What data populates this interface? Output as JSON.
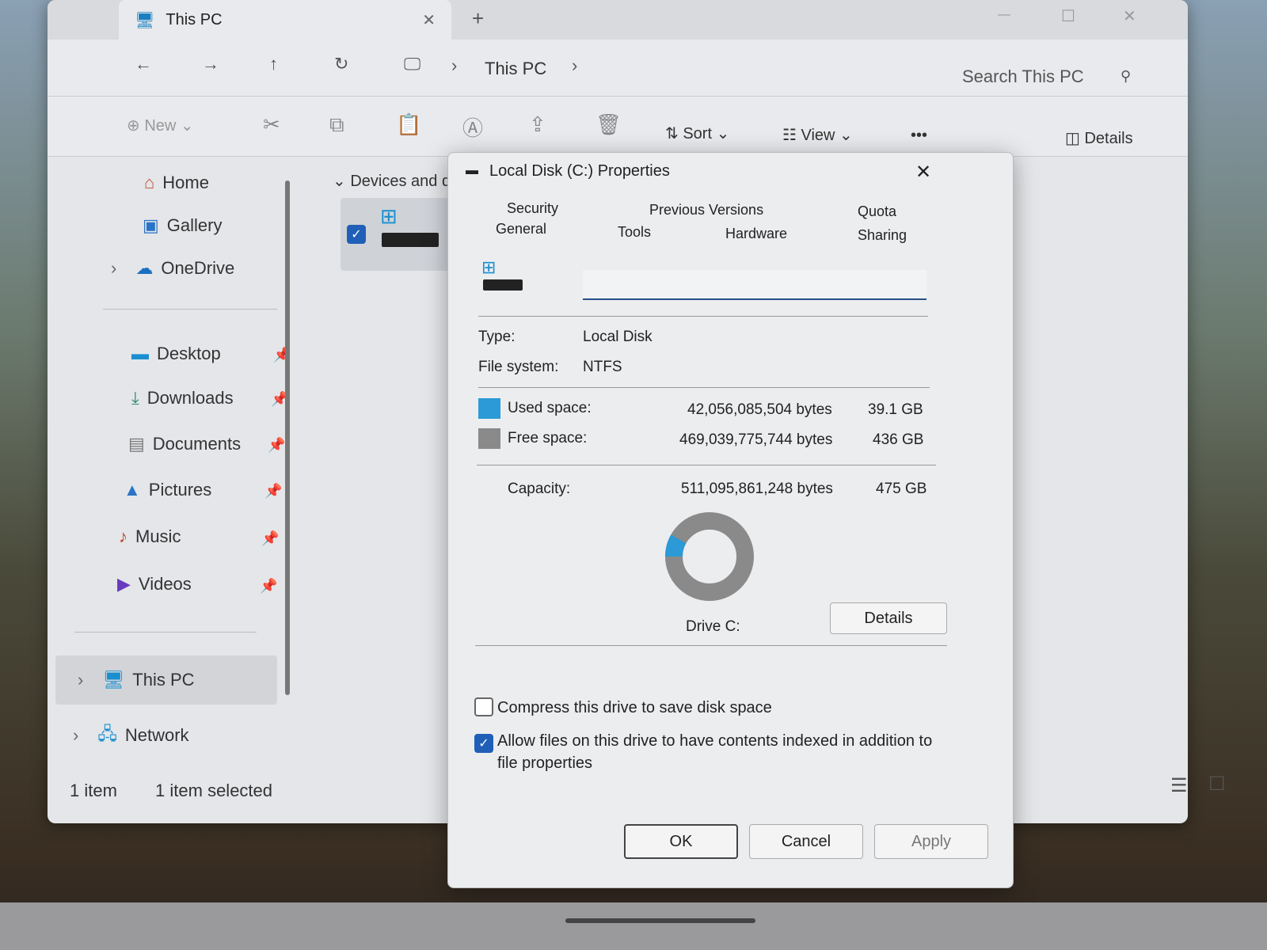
{
  "window": {
    "tab_title": "This PC",
    "new_tab": "+"
  },
  "nav": {
    "breadcrumb": [
      "This PC"
    ],
    "search_placeholder": "Search This PC"
  },
  "toolbar": {
    "new": "New",
    "sort": "Sort",
    "view": "View",
    "more": "•••",
    "details": "Details"
  },
  "sidebar": {
    "items": [
      {
        "label": "Home"
      },
      {
        "label": "Gallery"
      },
      {
        "label": "OneDrive"
      },
      {
        "label": "Desktop"
      },
      {
        "label": "Downloads"
      },
      {
        "label": "Documents"
      },
      {
        "label": "Pictures"
      },
      {
        "label": "Music"
      },
      {
        "label": "Videos"
      },
      {
        "label": "This PC"
      },
      {
        "label": "Network"
      }
    ]
  },
  "content": {
    "group": "Devices and d"
  },
  "status": {
    "count": "1 item",
    "selected": "1 item selected"
  },
  "dialog": {
    "title": "Local Disk (C:) Properties",
    "tabs_back": [
      "Security",
      "Previous Versions",
      "Quota"
    ],
    "tabs_front": [
      "General",
      "Tools",
      "Hardware",
      "Sharing"
    ],
    "name_value": "",
    "type_label": "Type:",
    "type_value": "Local Disk",
    "fs_label": "File system:",
    "fs_value": "NTFS",
    "used_label": "Used space:",
    "used_bytes": "42,056,085,504 bytes",
    "used_gb": "39.1 GB",
    "free_label": "Free space:",
    "free_bytes": "469,039,775,744 bytes",
    "free_gb": "436 GB",
    "cap_label": "Capacity:",
    "cap_bytes": "511,095,861,248 bytes",
    "cap_gb": "475 GB",
    "used_fraction": 0.082,
    "used_color": "#2b9ad6",
    "free_color": "#8a8a8a",
    "drive_label": "Drive C:",
    "details_button": "Details",
    "compress_label": "Compress this drive to save disk space",
    "compress_checked": false,
    "index_label": "Allow files on this drive to have contents indexed in addition to",
    "index_label2": "file properties",
    "index_checked": true,
    "ok": "OK",
    "cancel": "Cancel",
    "apply": "Apply"
  }
}
